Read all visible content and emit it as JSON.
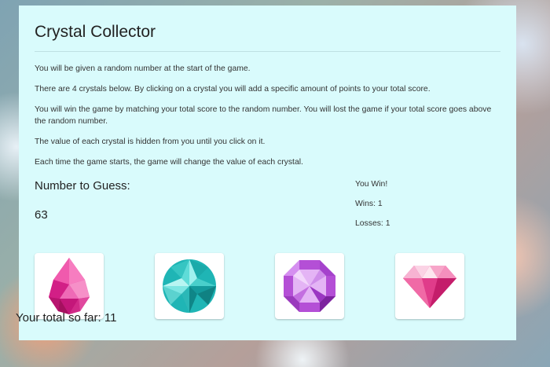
{
  "title": "Crystal Collector",
  "instructions": [
    "You will be given a random number at the start of the game.",
    "There are 4 crystals below. By clicking on a crystal you will add a specific amount of points to your total score.",
    "You will win the game by matching your total score to the random number. You will lost the game if your total score goes above the random number.",
    "The value of each crystal is hidden from you until you click on it.",
    "Each time the game starts, the game will change the value of each crystal."
  ],
  "guess": {
    "label": "Number to Guess:",
    "value": "63"
  },
  "status": {
    "message": "You Win!",
    "wins": "Wins: 1",
    "losses": "Losses: 1"
  },
  "crystals": [
    {
      "icon": "pink-teardrop-crystal-icon",
      "color": "#e8329a"
    },
    {
      "icon": "teal-round-crystal-icon",
      "color": "#1fb5b5"
    },
    {
      "icon": "purple-octagon-crystal-icon",
      "color": "#b44fd6"
    },
    {
      "icon": "pink-diamond-crystal-icon",
      "color": "#e5307f"
    }
  ],
  "total": {
    "text": "Your total so far: 11"
  }
}
